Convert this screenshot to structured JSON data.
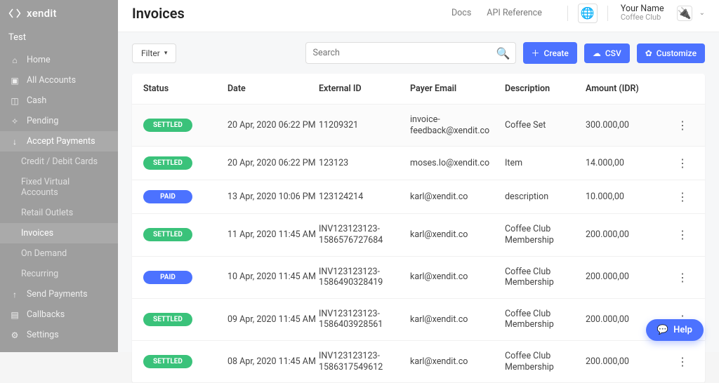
{
  "brand": "xendit",
  "mode": "Test",
  "sidebar": {
    "items": [
      {
        "label": "Home"
      },
      {
        "label": "All Accounts"
      },
      {
        "label": "Cash"
      },
      {
        "label": "Pending"
      },
      {
        "label": "Accept Payments"
      },
      {
        "label": "Credit / Debit Cards"
      },
      {
        "label": "Fixed Virtual Accounts"
      },
      {
        "label": "Retail Outlets"
      },
      {
        "label": "Invoices"
      },
      {
        "label": "On Demand"
      },
      {
        "label": "Recurring"
      },
      {
        "label": "Send Payments"
      },
      {
        "label": "Callbacks"
      },
      {
        "label": "Settings"
      }
    ]
  },
  "page_title": "Invoices",
  "top_links": {
    "docs": "Docs",
    "api": "API Reference"
  },
  "profile": {
    "name": "Your Name",
    "sub": "Coffee Club"
  },
  "toolbar": {
    "filter": "Filter",
    "search_placeholder": "Search",
    "create": "Create",
    "csv": "CSV",
    "customize": "Customize"
  },
  "table": {
    "headers": {
      "status": "Status",
      "date": "Date",
      "ext": "External ID",
      "email": "Payer Email",
      "desc": "Description",
      "amount": "Amount (IDR)"
    },
    "rows": [
      {
        "status": "SETTLED",
        "status_kind": "settled",
        "date": "20 Apr, 2020 06:22 PM",
        "ext": "11209321",
        "email": "invoice-feedback@xendit.co",
        "desc": "Coffee Set",
        "amount": "300.000,00"
      },
      {
        "status": "SETTLED",
        "status_kind": "settled",
        "date": "20 Apr, 2020 06:22 PM",
        "ext": "123123",
        "email": "moses.lo@xendit.co",
        "desc": "Item",
        "amount": "14.000,00"
      },
      {
        "status": "PAID",
        "status_kind": "paid",
        "date": "13 Apr, 2020 10:06 PM",
        "ext": "123124214",
        "email": "karl@xendit.co",
        "desc": "description",
        "amount": "10.000,00"
      },
      {
        "status": "SETTLED",
        "status_kind": "settled",
        "date": "11 Apr, 2020 11:45 AM",
        "ext": "INV123123123-1586576727684",
        "email": "karl@xendit.co",
        "desc": "Coffee Club Membership",
        "amount": "200.000,00"
      },
      {
        "status": "PAID",
        "status_kind": "paid",
        "date": "10 Apr, 2020 11:45 AM",
        "ext": "INV123123123-1586490328419",
        "email": "karl@xendit.co",
        "desc": "Coffee Club Membership",
        "amount": "200.000,00"
      },
      {
        "status": "SETTLED",
        "status_kind": "settled",
        "date": "09 Apr, 2020 11:45 AM",
        "ext": "INV123123123-1586403928561",
        "email": "karl@xendit.co",
        "desc": "Coffee Club Membership",
        "amount": "200.000,00"
      },
      {
        "status": "SETTLED",
        "status_kind": "settled",
        "date": "08 Apr, 2020 11:45 AM",
        "ext": "INV123123123-1586317549612",
        "email": "karl@xendit.co",
        "desc": "Coffee Club Membership",
        "amount": "200.000,00"
      }
    ]
  },
  "help_label": "Help"
}
